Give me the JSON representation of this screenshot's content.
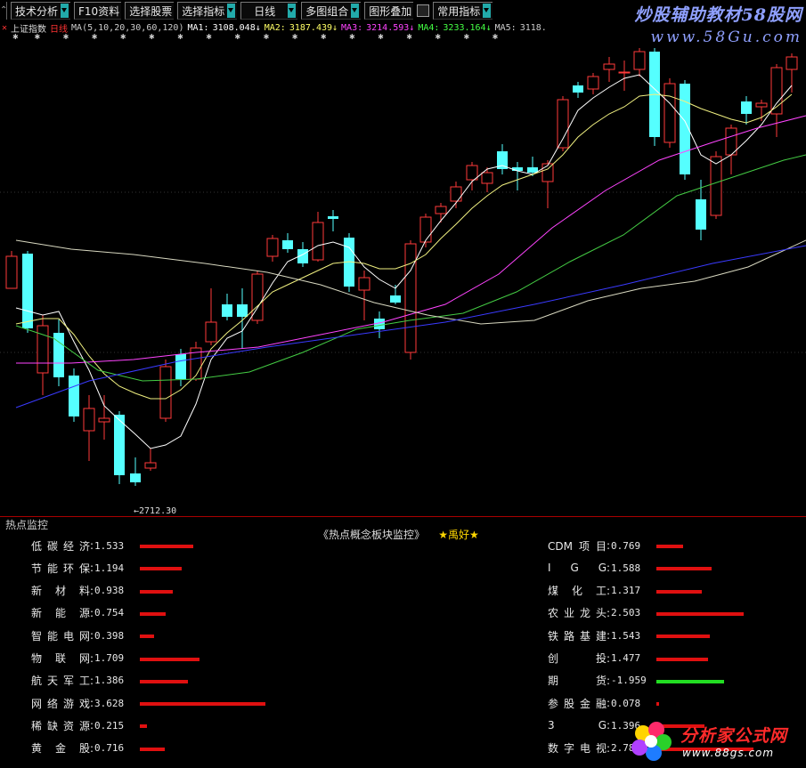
{
  "toolbar": {
    "buttons": [
      {
        "label": "技术分析"
      },
      {
        "label": "F10资料"
      },
      {
        "label": "选择股票"
      },
      {
        "label": "选择指标"
      },
      {
        "label": "日线"
      },
      {
        "label": "多图组合"
      },
      {
        "label": "图形叠加"
      },
      {
        "label": "常用指标"
      }
    ]
  },
  "watermark": {
    "title": "炒股辅助教材58股网",
    "url": "www.58Gu.com"
  },
  "chart": {
    "index_name": "上证指数",
    "period": "日线",
    "ma_params": "MA(5,10,20,30,60,120)",
    "ma_values": [
      {
        "label": "MA1:",
        "value": "3108.048↓",
        "color": "#ffffff"
      },
      {
        "label": "MA2:",
        "value": "3187.439↓",
        "color": "#ffff66"
      },
      {
        "label": "MA3:",
        "value": "3214.593↓",
        "color": "#ff44ff"
      },
      {
        "label": "MA4:",
        "value": "3233.164↓",
        "color": "#44ff44"
      },
      {
        "label": "MA5:",
        "value": "3118. ",
        "color": "#cccccc"
      }
    ],
    "low_label": "←2712.30",
    "colors": {
      "up": "#ff3a3a",
      "down": "#5ff",
      "ma1": "#ffffff",
      "ma2": "#f0f080",
      "ma3": "#ff44ff",
      "ma4": "#44cc44",
      "ma5": "#d8d8c0",
      "ma6": "#3a3aff"
    }
  },
  "hotspot": {
    "panel_title": "热点监控",
    "heading": "《热点概念板块监控》",
    "heading_stars": "★禹好★",
    "left": [
      {
        "name": "低碳经济",
        "value": "1.533",
        "color": "#e01010",
        "level": 1.533
      },
      {
        "name": "节能环保",
        "value": "1.194",
        "color": "#e01010",
        "level": 1.194
      },
      {
        "name": "新 材 料",
        "value": "0.938",
        "color": "#e01010",
        "level": 0.938
      },
      {
        "name": "新 能 源",
        "value": "0.754",
        "color": "#e01010",
        "level": 0.754
      },
      {
        "name": "智能电网",
        "value": "0.398",
        "color": "#e01010",
        "level": 0.398
      },
      {
        "name": "物 联 网",
        "value": "1.709",
        "color": "#e01010",
        "level": 1.709
      },
      {
        "name": "航天军工",
        "value": "1.386",
        "color": "#e01010",
        "level": 1.386
      },
      {
        "name": "网络游戏",
        "value": "3.628",
        "color": "#e01010",
        "level": 3.628
      },
      {
        "name": "稀缺资源",
        "value": "0.215",
        "color": "#e01010",
        "level": 0.215
      },
      {
        "name": "黄 金 股",
        "value": "0.716",
        "color": "#e01010",
        "level": 0.716
      }
    ],
    "right": [
      {
        "name": "CDM项目",
        "value": "0.769",
        "color": "#e01010",
        "level": 0.769
      },
      {
        "name": "I G G",
        "value": "1.588",
        "color": "#e01010",
        "level": 1.588
      },
      {
        "name": "煤 化 工",
        "value": "1.317",
        "color": "#e01010",
        "level": 1.317
      },
      {
        "name": "农业龙头",
        "value": "2.503",
        "color": "#e01010",
        "level": 2.503
      },
      {
        "name": "铁路基建",
        "value": "1.543",
        "color": "#e01010",
        "level": 1.543
      },
      {
        "name": "创 投",
        "value": "1.477",
        "color": "#e01010",
        "level": 1.477
      },
      {
        "name": "期 货",
        "value": "-1.959",
        "color": "#22dd22",
        "level": 1.959
      },
      {
        "name": "参股金融",
        "value": "0.078",
        "color": "#e01010",
        "level": 0.078
      },
      {
        "name": "3 G",
        "value": "1.396",
        "color": "#e01010",
        "level": 1.396
      },
      {
        "name": "数字电视",
        "value": "2.789",
        "color": "#e01010",
        "level": 2.789
      }
    ]
  },
  "logo": {
    "name": "分析家公式网",
    "url": "www.88gs.com"
  }
}
